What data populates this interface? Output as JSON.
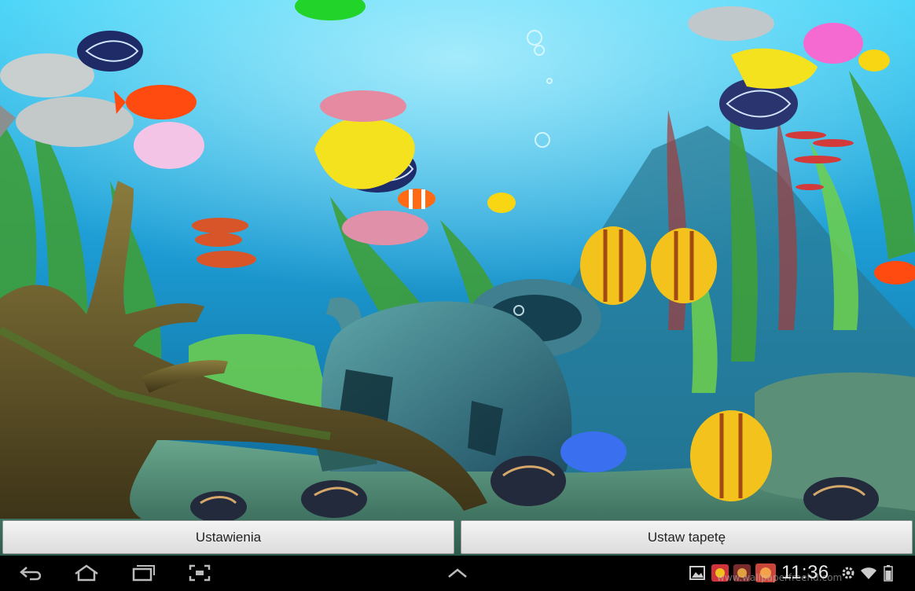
{
  "buttons": {
    "settings_label": "Ustawienia",
    "set_wallpaper_label": "Ustaw tapetę"
  },
  "status_bar": {
    "time": "11:36",
    "icons": [
      "gallery-notification-icon",
      "app-notification-icon-1",
      "app-notification-icon-2",
      "app-notification-icon-3",
      "settings-gear-icon",
      "wifi-icon",
      "battery-icon"
    ]
  },
  "nav_bar": {
    "icons": [
      "back-icon",
      "home-icon",
      "recent-apps-icon",
      "screenshot-icon",
      "expand-up-icon"
    ]
  },
  "watermark": "www.wallpaperfreehd.com",
  "colors": {
    "water_top": "#2ec3ee",
    "water_mid": "#1a8fc7",
    "button_bg": "#e6e6e6",
    "system_bar": "#000000"
  }
}
